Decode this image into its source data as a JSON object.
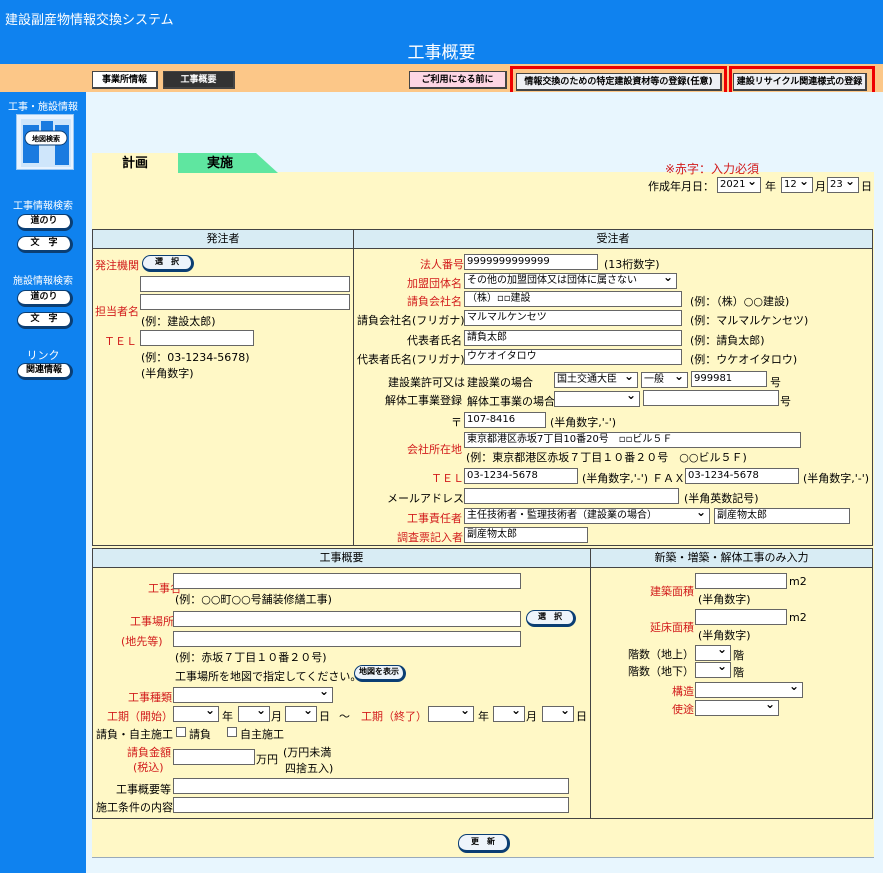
{
  "header": {
    "system_title": "建設副産物情報交換システム",
    "page_title": "工事概要"
  },
  "nav": {
    "office_info": "事業所情報",
    "project_overview": "工事概要",
    "before_use": "ご利用になる前に",
    "register_materials": "情報交換のための特定建設資材等の登録(任意)",
    "register_recycle": "建設リサイクル関連様式の登録"
  },
  "sidebar": {
    "project_facility_info": "工事・施設情報",
    "map_search": "地図検索",
    "project_search": "工事情報検索",
    "road_btn": "道のり",
    "text_btn": "文　字",
    "facility_search": "施設情報検索",
    "link": "リンク",
    "related_info": "関連情報"
  },
  "tabs": {
    "plan": "計画",
    "execution": "実施"
  },
  "notice": "※赤字：入力必須",
  "creation_date": {
    "label": "作成年月日：",
    "year": "2021",
    "year_unit": "年",
    "month": "12",
    "month_unit": "月",
    "day": "23",
    "day_unit": "日"
  },
  "orderer": {
    "header": "発注者",
    "agency_label": "発注機関",
    "select_btn": "選　択",
    "person_label": "担当者名",
    "person_example": "(例：建設太郎)",
    "tel_label": "ＴＥＬ",
    "tel_example": "(例：03-1234-5678)",
    "tel_hint": "(半角数字)"
  },
  "contractor": {
    "header": "受注者",
    "corp_no_label": "法人番号",
    "corp_no": "9999999999999",
    "corp_no_hint": "(13桁数字)",
    "assoc_label": "加盟団体名",
    "assoc": "その他の加盟団体又は団体に属さない",
    "company_label": "請負会社名",
    "company": "（株）▫▫建設",
    "company_example": "(例：（株）○○建設)",
    "company_kana_label": "請負会社名(フリガナ)",
    "company_kana": "マルマルケンセツ",
    "company_kana_example": "(例：マルマルケンセツ)",
    "rep_label": "代表者氏名",
    "rep": "請負太郎",
    "rep_example": "(例：請負太郎)",
    "rep_kana_label": "代表者氏名(フリガナ)",
    "rep_kana": "ウケオイタロウ",
    "rep_kana_example": "(例：ウケオイタロウ)",
    "license_label": "建設業許可又は",
    "construction_case": "建設業の場合",
    "license_minister": "国土交通大臣",
    "license_type": "一般",
    "license_no": "999981",
    "license_unit": "号",
    "demolition_label": "解体工事業登録",
    "demolition_case": "解体工事業の場合",
    "demolition_unit": "号",
    "postal_mark": "〒",
    "postal": "107-8416",
    "postal_hint": "(半角数字,'-')",
    "address_label": "会社所在地",
    "address": "東京都港区赤坂7丁目10番20号　▫▫ビル５Ｆ",
    "address_example": "(例：東京都港区赤坂７丁目１０番２０号　○○ビル５Ｆ)",
    "tel_label": "ＴＥＬ",
    "tel": "03-1234-5678",
    "tel_hint": "(半角数字,'-')",
    "fax_label": "ＦＡＸ",
    "fax": "03-1234-5678",
    "fax_hint": "(半角数字,'-')",
    "email_label": "メールアドレス",
    "email_hint": "(半角英数記号)",
    "manager_label": "工事責任者",
    "manager_type": "主任技術者・監理技術者（建設業の場合）",
    "manager_name": "副産物太郎",
    "filler_label": "調査票記入者",
    "filler": "副産物太郎"
  },
  "project": {
    "header": "工事概要",
    "name_label": "工事名",
    "name_example": "(例：○○町○○号舗装修繕工事)",
    "site_label": "工事場所",
    "site_select": "選　択",
    "site_detail_label": "(地先等)",
    "site_example": "(例：赤坂７丁目１０番２０号)",
    "map_instruction": "工事場所を地図で指定してください。",
    "map_btn": "地図を表示",
    "type_label": "工事種類",
    "period_start_label": "工期（開始）",
    "period_end_label": "工期（終了）",
    "year_unit": "年",
    "month_unit": "月",
    "day_unit": "日",
    "tilde": "～",
    "contract_label": "請負・自主施工",
    "contract_opt": "請負",
    "self_opt": "自主施工",
    "amount_label1": "請負金額",
    "amount_label2": "(税込)",
    "amount_unit": "万円",
    "amount_hint1": "(万円未満",
    "amount_hint2": "四捨五入)",
    "summary_label": "工事概要等",
    "conditions_label": "施工条件の内容"
  },
  "building": {
    "header": "新築・増築・解体工事のみ入力",
    "area_label": "建築面積",
    "area_unit": "m2",
    "area_hint": "(半角数字)",
    "floor_area_label": "延床面積",
    "floor_area_unit": "m2",
    "floor_area_hint": "(半角数字)",
    "floors_above_label": "階数（地上）",
    "floors_unit": "階",
    "floors_below_label": "階数（地下）",
    "floors_below_unit": "階",
    "structure_label": "構造",
    "use_label": "使途"
  },
  "update_btn": "更　新"
}
